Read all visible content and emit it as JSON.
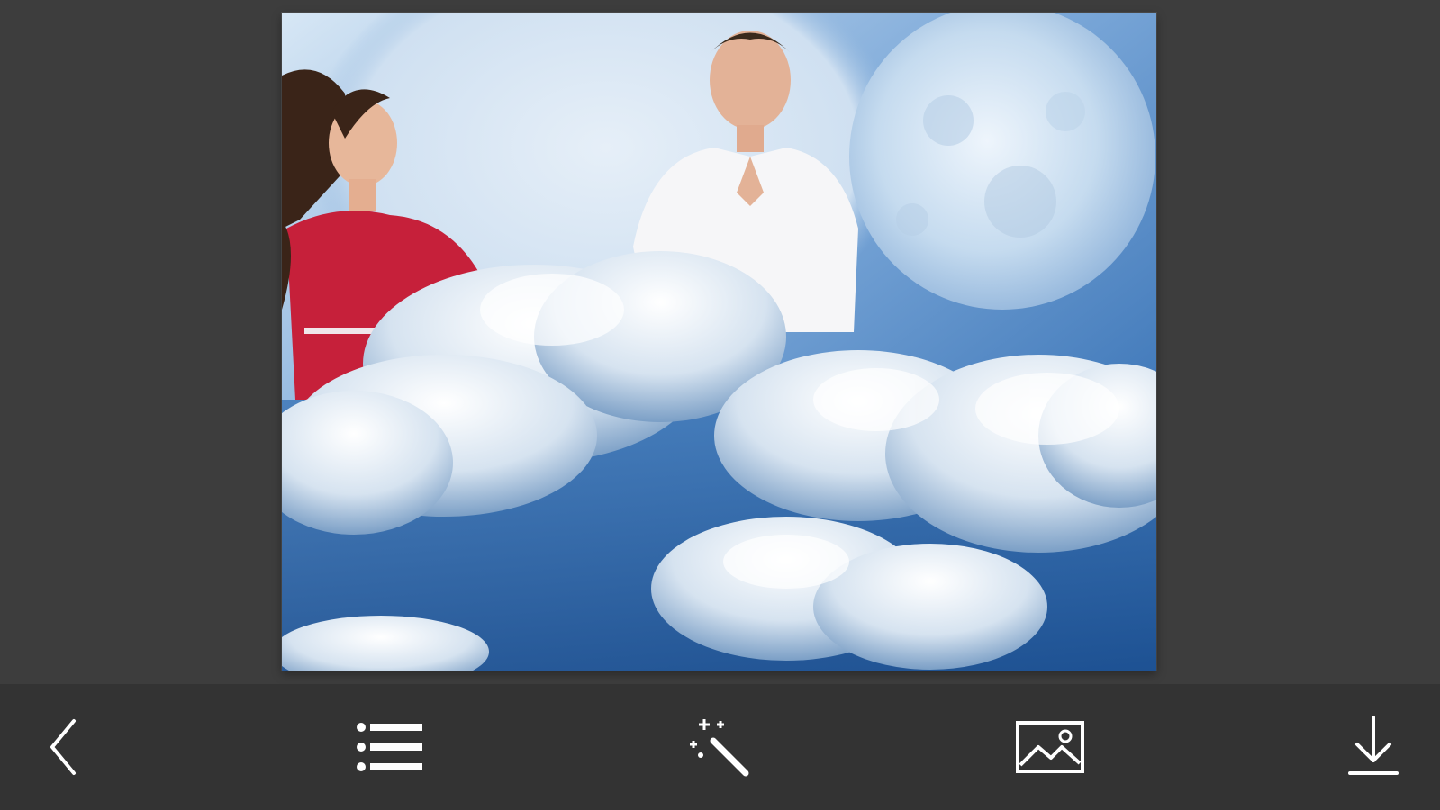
{
  "photo": {
    "description_icon": "photo-frame-image",
    "sky_color": "#2f6db0",
    "accent_light": "#cfe3f4"
  },
  "toolbar": {
    "buttons": [
      {
        "name": "back-button",
        "icon": "chevron-left-icon"
      },
      {
        "name": "frames-list-button",
        "icon": "list-icon"
      },
      {
        "name": "effects-button",
        "icon": "magic-wand-icon"
      },
      {
        "name": "gallery-button",
        "icon": "image-icon"
      },
      {
        "name": "save-button",
        "icon": "download-icon"
      }
    ],
    "icon_color": "#ffffff"
  }
}
